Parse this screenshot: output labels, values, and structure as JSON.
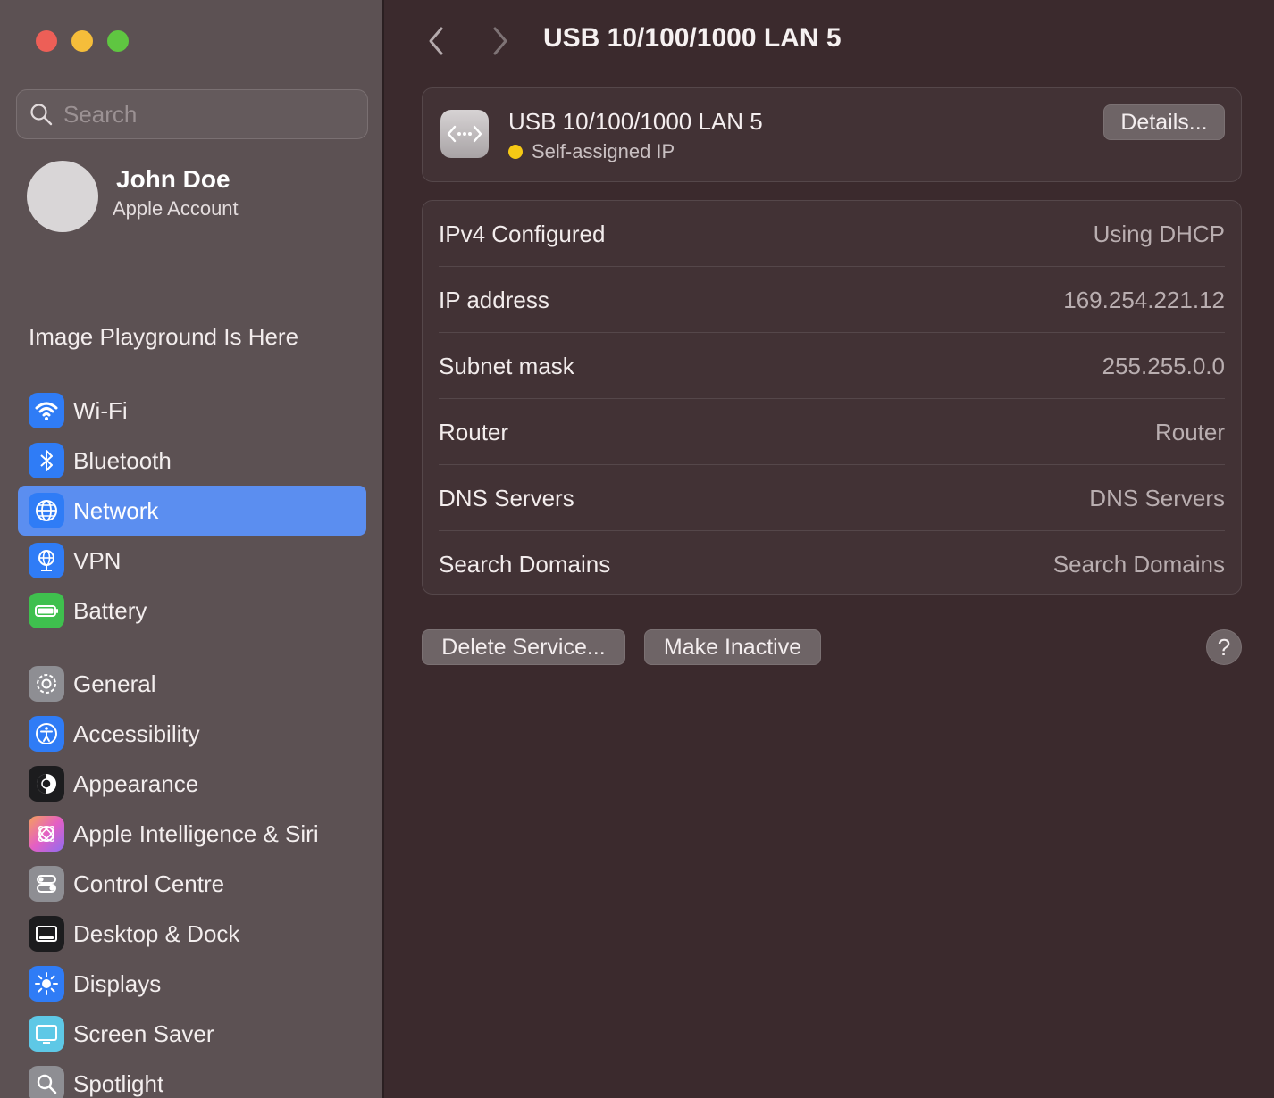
{
  "window": {
    "colors": {
      "close": "#ed5f57",
      "minimize": "#f5bd3a",
      "zoom": "#5fc641",
      "accent": "#5b8ef0"
    }
  },
  "sidebar": {
    "search": {
      "placeholder": "Search"
    },
    "account": {
      "name": "John Doe",
      "subtitle": "Apple Account"
    },
    "promo": "Image Playground Is Here",
    "items": [
      {
        "label": "Wi-Fi",
        "icon": "wifi-icon",
        "color": "#2f7cf6"
      },
      {
        "label": "Bluetooth",
        "icon": "bluetooth-icon",
        "color": "#2f7cf6"
      },
      {
        "label": "Network",
        "icon": "globe-icon",
        "color": "#2f7cf6",
        "active": true
      },
      {
        "label": "VPN",
        "icon": "vpn-globe-icon",
        "color": "#2f7cf6"
      },
      {
        "label": "Battery",
        "icon": "battery-icon",
        "color": "#3fc04e"
      },
      {
        "label": "General",
        "icon": "gear-icon",
        "color": "#8e8e93"
      },
      {
        "label": "Accessibility",
        "icon": "accessibility-icon",
        "color": "#2f7cf6"
      },
      {
        "label": "Appearance",
        "icon": "appearance-icon",
        "color": "#1c1c1e"
      },
      {
        "label": "Apple Intelligence & Siri",
        "icon": "siri-icon",
        "color": "#d66fe0"
      },
      {
        "label": "Control Centre",
        "icon": "control-centre-icon",
        "color": "#8e8e93"
      },
      {
        "label": "Desktop & Dock",
        "icon": "dock-icon",
        "color": "#1c1c1e"
      },
      {
        "label": "Displays",
        "icon": "sun-icon",
        "color": "#2f7cf6"
      },
      {
        "label": "Screen Saver",
        "icon": "screen-saver-icon",
        "color": "#5ec8e6"
      },
      {
        "label": "Spotlight",
        "icon": "magnifier-icon",
        "color": "#8e8e93"
      }
    ]
  },
  "main": {
    "title": "USB 10/100/1000 LAN 5",
    "service": {
      "name": "USB 10/100/1000 LAN 5",
      "status": "Self-assigned IP",
      "status_color": "#f6c915",
      "icon": "ethernet-icon",
      "details_label": "Details..."
    },
    "rows": [
      {
        "label": "IPv4 Configured",
        "value": "Using DHCP"
      },
      {
        "label": "IP address",
        "value": "169.254.221.12"
      },
      {
        "label": "Subnet mask",
        "value": "255.255.0.0"
      },
      {
        "label": "Router",
        "value": "Router"
      },
      {
        "label": "DNS Servers",
        "value": "DNS Servers"
      },
      {
        "label": "Search Domains",
        "value": "Search Domains"
      }
    ],
    "actions": {
      "delete_label": "Delete Service...",
      "inactive_label": "Make Inactive",
      "help_label": "?"
    }
  }
}
